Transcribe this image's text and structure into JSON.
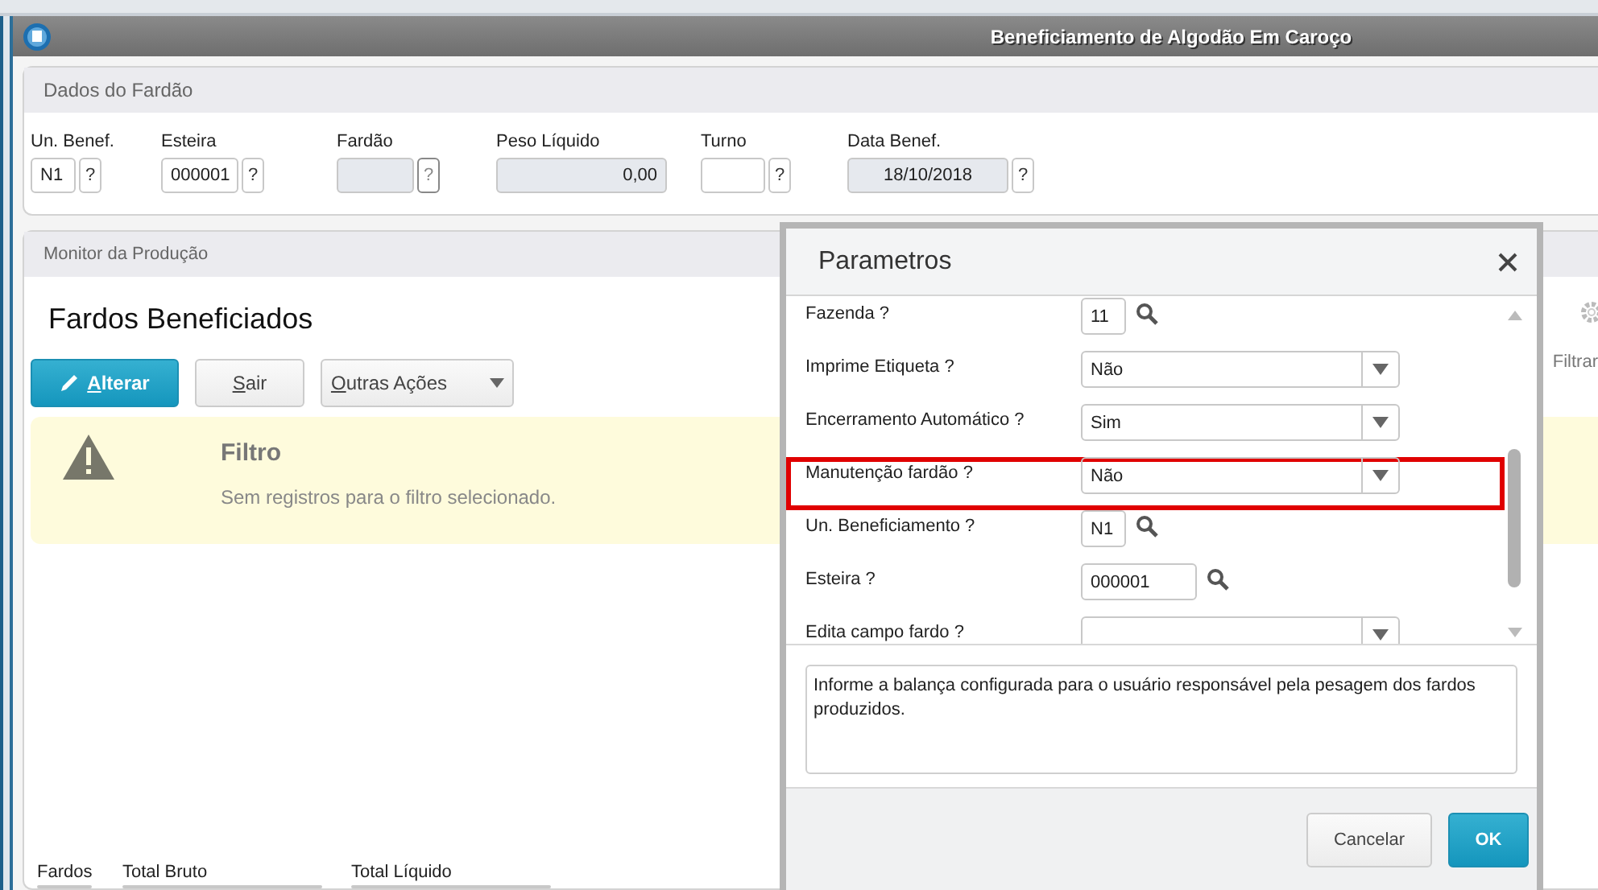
{
  "window": {
    "title": "Beneficiamento de Algodão Em Caroço"
  },
  "bale_panel": {
    "title": "Dados do Fardão",
    "fields": [
      {
        "label": "Un. Benef.",
        "value": "N1",
        "kind": "text",
        "disabled": false,
        "help": "?"
      },
      {
        "label": "Esteira",
        "value": "000001",
        "kind": "text",
        "disabled": false,
        "help": "?"
      },
      {
        "label": "Fardão",
        "kind": "text",
        "disabled": true,
        "help": "?"
      },
      {
        "label": "Peso Líquido",
        "value": "0,00",
        "kind": "number",
        "disabled": true
      },
      {
        "label": "Turno",
        "kind": "text",
        "disabled": false,
        "help": "?"
      },
      {
        "label": "Data Benef.",
        "value": "18/10/2018",
        "kind": "date",
        "disabled": true,
        "help": "?"
      }
    ]
  },
  "monitor_panel": {
    "title": "Monitor da Produção",
    "heading": "Fardos Beneficiados",
    "buttons": [
      {
        "label": "Alterar",
        "kind": "primary"
      },
      {
        "label": "Sair",
        "kind": "default"
      },
      {
        "label": "Outras Ações",
        "kind": "dropdown"
      }
    ],
    "filter_link": "Filtrar",
    "alert": {
      "title": "Filtro",
      "message": "Sem registros para o filtro selecionado."
    },
    "totals": [
      {
        "label": "Fardos"
      },
      {
        "label": "Total Bruto"
      },
      {
        "label": "Total Líquido"
      }
    ]
  },
  "dialog": {
    "title": "Parametros",
    "params": [
      {
        "label": "Fazenda ?",
        "kind": "lookup",
        "value": "11",
        "highlighted": false
      },
      {
        "label": "Imprime Etiqueta ?",
        "kind": "select",
        "value": "Não",
        "highlighted": false
      },
      {
        "label": "Encerramento Automático ?",
        "kind": "select",
        "value": "Sim",
        "highlighted": false
      },
      {
        "label": "Manutenção fardão ?",
        "kind": "select",
        "value": "Não",
        "highlighted": true
      },
      {
        "label": "Un. Beneficiamento ?",
        "kind": "lookup",
        "value": "N1",
        "highlighted": false
      },
      {
        "label": "Esteira ?",
        "kind": "lookup",
        "value": "000001",
        "highlighted": false
      },
      {
        "label": "Edita campo fardo ?",
        "kind": "select",
        "highlighted": false
      }
    ],
    "description": "Informe a balança configurada para o usuário responsável pela pesagem dos fardos produzidos.",
    "buttons": [
      {
        "label": "Cancelar",
        "kind": "default"
      },
      {
        "label": "OK",
        "kind": "primary"
      }
    ]
  }
}
